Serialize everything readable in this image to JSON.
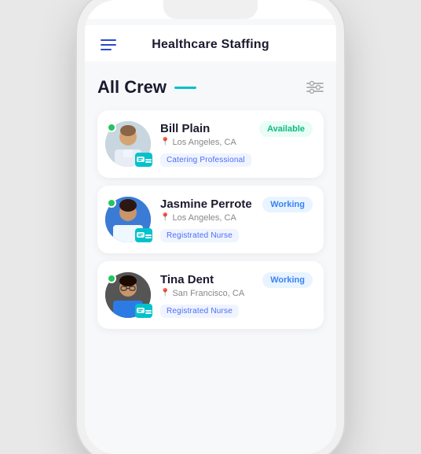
{
  "header": {
    "title": "Healthcare Staffing",
    "menu_icon": "hamburger"
  },
  "section": {
    "title": "All Crew",
    "filter_icon": "sliders"
  },
  "crew": [
    {
      "id": "bill-plain",
      "name": "Bill Plain",
      "location": "Los Angeles, CA",
      "tag": "Catering Professional",
      "status": "Available",
      "status_type": "available",
      "avatar_style": "bill"
    },
    {
      "id": "jasmine-perrote",
      "name": "Jasmine Perrote",
      "location": "Los Angeles, CA",
      "tag": "Registrated Nurse",
      "status": "Working",
      "status_type": "working",
      "avatar_style": "jasmine"
    },
    {
      "id": "tina-dent",
      "name": "Tina Dent",
      "location": "San Francisco, CA",
      "tag": "Registrated Nurse",
      "status": "Working",
      "status_type": "working",
      "avatar_style": "tina"
    }
  ]
}
